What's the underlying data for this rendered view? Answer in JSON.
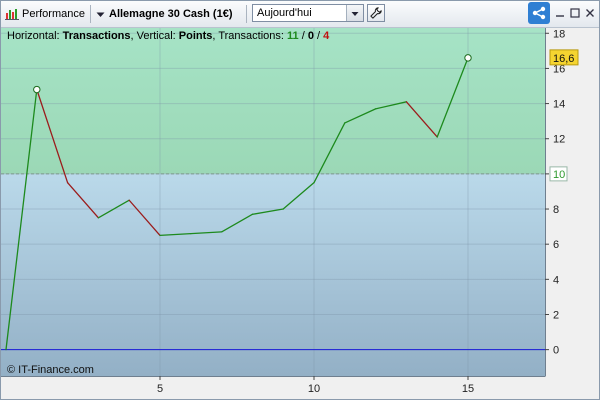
{
  "toolbar": {
    "app_label": "Performance",
    "instrument": "Allemagne 30 Cash (1€)",
    "period_selected": "Aujourd'hui",
    "icons": [
      "performance-chart-icon",
      "dropdown-arrow-icon",
      "wrench-icon",
      "share-icon",
      "minimize-icon",
      "maximize-icon",
      "close-icon"
    ]
  },
  "info": {
    "horizontal_prefix": "Horizontal: ",
    "horizontal_value": "Transactions",
    "vertical_prefix": ", Vertical: ",
    "vertical_value": "Points",
    "transactions_prefix": ", Transactions: ",
    "wins": "11",
    "slash1": " / ",
    "neutral": "0",
    "slash2": " / ",
    "losses": "4"
  },
  "watermark": "© IT-Finance.com",
  "colors": {
    "gain_segment": "#1d8a1d",
    "loss_segment": "#9b1c1c",
    "zero_line": "#1a1ad8",
    "wins_text": "#1d8a1d",
    "losses_text": "#c01010",
    "last_value_badge": "#f5d430",
    "reference_badge_text": "#2e9a2e"
  },
  "chart_data": {
    "type": "line",
    "x": [
      0,
      1,
      2,
      3,
      4,
      5,
      6,
      7,
      8,
      9,
      10,
      11,
      12,
      13,
      14,
      15
    ],
    "y": [
      0,
      14.8,
      9.5,
      7.5,
      8.5,
      6.5,
      6.6,
      6.7,
      7.7,
      8.0,
      9.5,
      12.9,
      13.7,
      14.1,
      12.1,
      16.6
    ],
    "xlim": [
      0,
      17.5
    ],
    "ylim": [
      -1.5,
      18.3
    ],
    "x_ticks": [
      "5",
      "10",
      "15"
    ],
    "x_tick_values": [
      5,
      10,
      15
    ],
    "y_ticks": [
      "0",
      "2",
      "4",
      "6",
      "8",
      "10",
      "12",
      "14",
      "16",
      "18"
    ],
    "y_tick_values": [
      0,
      2,
      4,
      6,
      8,
      10,
      12,
      14,
      16,
      18
    ],
    "reference_level": 10,
    "reference_label": "10",
    "last_value_label": "16,6",
    "highlighted_points": [
      1,
      15
    ],
    "grid": true,
    "legend": "none"
  }
}
